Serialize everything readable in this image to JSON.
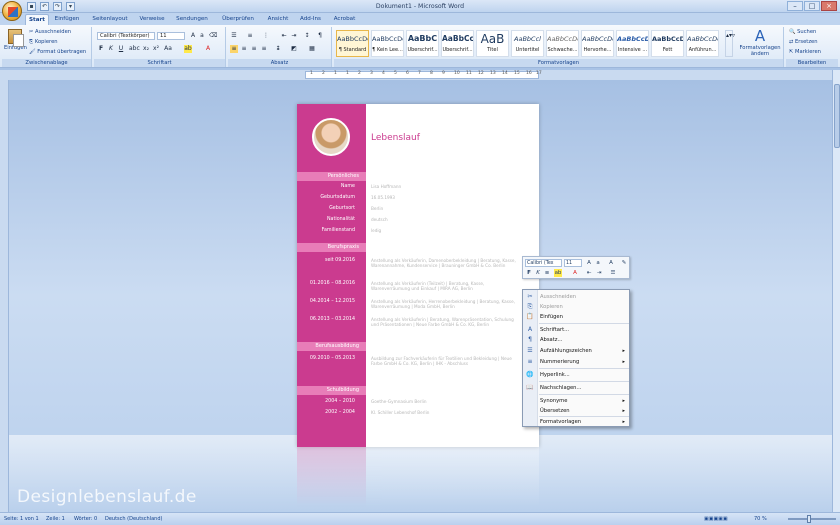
{
  "window": {
    "title": "Dokument1 - Microsoft Word",
    "controls": [
      "–",
      "□",
      "×"
    ]
  },
  "quick_access": [
    "save",
    "undo",
    "redo",
    "more"
  ],
  "tabs": [
    "Start",
    "Einfügen",
    "Seitenlayout",
    "Verweise",
    "Sendungen",
    "Überprüfen",
    "Ansicht",
    "Add-Ins",
    "Acrobat"
  ],
  "ribbon": {
    "clipboard": {
      "paste": "Einfügen",
      "cut": "Ausschneiden",
      "copy": "Kopieren",
      "format": "Format übertragen",
      "label": "Zwischenablage"
    },
    "font": {
      "name": "Calibri (Textkörper)",
      "size": "11",
      "label": "Schriftart",
      "bold": "F",
      "italic": "K",
      "underline": "U"
    },
    "paragraph": {
      "label": "Absatz"
    },
    "styles": {
      "label": "Formatvorlagen",
      "change": "Formatvorlagen ändern",
      "items": [
        {
          "sample": "AaBbCcDc",
          "name": "¶ Standard"
        },
        {
          "sample": "AaBbCcDc",
          "name": "¶ Kein Lee..."
        },
        {
          "sample": "AaBbC",
          "name": "Überschrif..."
        },
        {
          "sample": "AaBbCc",
          "name": "Überschrif..."
        },
        {
          "sample": "AaB",
          "name": "Titel"
        },
        {
          "sample": "AaBbCcl",
          "name": "Untertitel"
        },
        {
          "sample": "AaBbCcDc",
          "name": "Schwache..."
        },
        {
          "sample": "AaBbCcDc",
          "name": "Hervorhe..."
        },
        {
          "sample": "AaBbCcDc",
          "name": "Intensive ..."
        },
        {
          "sample": "AaBbCcDc",
          "name": "Fett"
        },
        {
          "sample": "AaBbCcDc",
          "name": "Anführun..."
        }
      ]
    },
    "editing": {
      "find": "Suchen",
      "replace": "Ersetzen",
      "select": "Markieren",
      "label": "Bearbeiten"
    }
  },
  "ruler": [
    "1",
    "2",
    "1",
    "1",
    "2",
    "3",
    "4",
    "5",
    "6",
    "7",
    "8",
    "9",
    "10",
    "11",
    "12",
    "13",
    "14",
    "15",
    "16",
    "17"
  ],
  "document": {
    "title": "Lebenslauf",
    "personal": {
      "header": "Persönliches",
      "labels": [
        "Name",
        "Geburtsdatum",
        "Geburtsort",
        "Nationalität",
        "Familienstand"
      ],
      "values": [
        "Lisa Hoffmann",
        "16.05.1993",
        "Berlin",
        "deutsch",
        "ledig"
      ]
    },
    "career": {
      "header": "Berufspraxis",
      "dates": [
        "seit 09.2016",
        "01.2016 – 08.2016",
        "04.2014 – 12.2015",
        "06.2013 – 03.2014"
      ],
      "texts": [
        "Anstellung als Verkäuferin, Damenoberbekleidung  |  Beratung, Kasse, Warenannahme, Kundenservice  |  Brauninger GmbH & Co. Berlin",
        "Anstellung als Verkäuferin (Teilzeit)  |  Beratung, Kasse, Warenverräumung und Einkauf  |  MIRA AG, Berlin",
        "Anstellung als Verkäuferin, Herrenoberbekleidung  |  Beratung, Kasse, Warenverräumung  |  Moda GmbH, Berlin",
        "Anstellung als Verkäuferin  |  Beratung, Warenpräsentation, Schulung und Präsentationen  |  Neue Farbe GmbH & Co. KG, Berlin"
      ]
    },
    "training": {
      "header": "Berufsausbildung",
      "dates": [
        "09.2010 – 05.2013"
      ],
      "texts": [
        "Ausbildung zur Fachverkäuferin für Textilien und Bekleidung  |  Neue Farbe GmbH & Co. KG, Berlin  |  IHK - Abschluss"
      ]
    },
    "school": {
      "header": "Schulbildung",
      "dates": [
        "2004 – 2010",
        "2002 – 2004"
      ],
      "texts": [
        "Goethe-Gymnasium Berlin",
        "Kl. Schiller Lebenshof Berlin"
      ]
    }
  },
  "minibar": {
    "font": "Calibri (Tex",
    "size": "11"
  },
  "context_menu": [
    {
      "label": "Ausschneiden",
      "icon": "cut-icon",
      "disabled": true
    },
    {
      "label": "Kopieren",
      "icon": "copy-icon",
      "disabled": true
    },
    {
      "label": "Einfügen",
      "icon": "paste-icon",
      "disabled": false
    },
    {
      "label": "Schriftart...",
      "icon": "font-icon",
      "disabled": false
    },
    {
      "label": "Absatz...",
      "icon": "paragraph-icon",
      "disabled": false
    },
    {
      "label": "Aufzählungszeichen",
      "icon": "bullets-icon",
      "submenu": true
    },
    {
      "label": "Nummerierung",
      "icon": "numbering-icon",
      "submenu": true
    },
    {
      "label": "Hyperlink...",
      "icon": "hyperlink-icon"
    },
    {
      "label": "Nachschlagen...",
      "icon": "lookup-icon"
    },
    {
      "label": "Synonyme",
      "icon": "",
      "submenu": true
    },
    {
      "label": "Übersetzen",
      "icon": "",
      "submenu": true
    },
    {
      "label": "Formatvorlagen",
      "icon": "",
      "submenu": true
    }
  ],
  "watermark": "Designlebenslauf.de",
  "status": {
    "page": "Seite: 1 von 1",
    "line": "Zeile: 1",
    "words": "Wörter: 0",
    "language": "Deutsch (Deutschland)",
    "zoom": "70 %"
  }
}
